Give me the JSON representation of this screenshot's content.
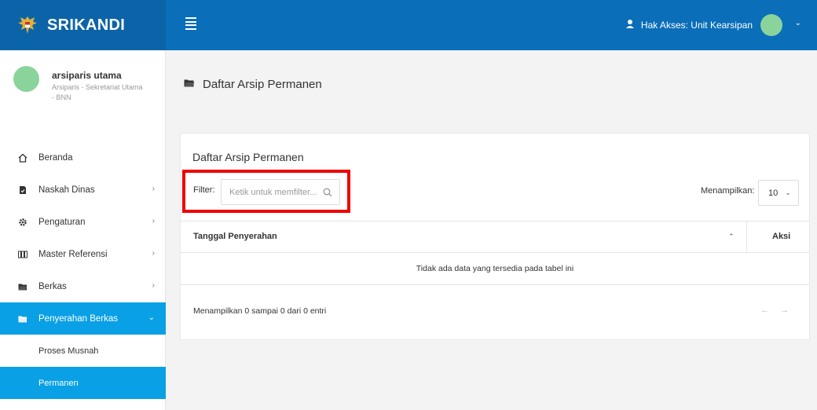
{
  "app": {
    "brand": "SRIKANDI"
  },
  "header": {
    "access_text": "Hak Akses: Unit Kearsipan"
  },
  "user": {
    "name": "arsiparis utama",
    "role": "Arsiparis - Sekretariat Utama - BNN"
  },
  "sidebar": {
    "items": [
      {
        "label": "Beranda",
        "icon": "home-icon"
      },
      {
        "label": "Naskah Dinas",
        "icon": "document-icon"
      },
      {
        "label": "Pengaturan",
        "icon": "gear-icon"
      },
      {
        "label": "Master Referensi",
        "icon": "grid-icon"
      },
      {
        "label": "Berkas",
        "icon": "folder-icon"
      },
      {
        "label": "Penyerahan Berkas",
        "icon": "folder-open-icon",
        "active": true
      }
    ],
    "subitems": [
      {
        "label": "Proses Musnah"
      },
      {
        "label": "Permanen",
        "selected": true
      }
    ]
  },
  "main": {
    "page_title": "Daftar Arsip Permanen",
    "card_title": "Daftar Arsip Permanen",
    "filter_label": "Filter:",
    "filter_placeholder": "Ketik untuk memfilter...",
    "show_label": "Menampilkan:",
    "show_value": "10",
    "table": {
      "columns": [
        "Tanggal Penyerahan",
        "Aksi"
      ],
      "empty_text": "Tidak ada data yang tersedia pada tabel ini"
    },
    "info": "Menampilkan 0 sampai 0 dari 0 entri",
    "pager": {
      "prev": "←",
      "next": "→"
    }
  },
  "colors": {
    "topbar": "#0a6eb9",
    "brand_bg": "#0c64a8",
    "active": "#0aa0e6",
    "highlight": "#ee0000",
    "avatar": "#8ad49b"
  }
}
